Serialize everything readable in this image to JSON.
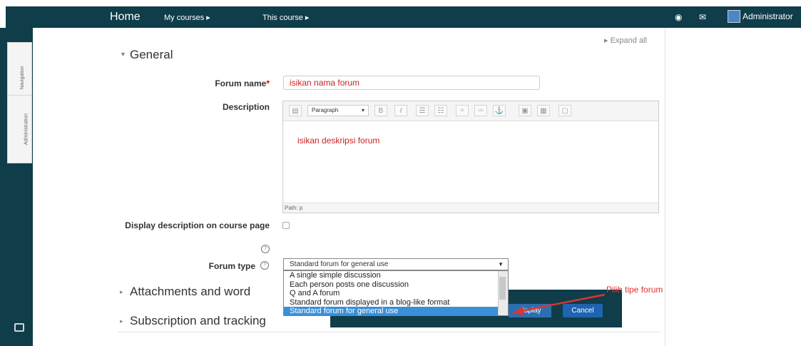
{
  "topbar": {
    "home": "Home",
    "my_courses": "My courses ▸",
    "this_course": "This course ▸",
    "user": "Administrator"
  },
  "left_dock": {
    "navigation": "Navigation",
    "administration": "Administration"
  },
  "form": {
    "expand_all": "Expand all",
    "general_title": "General",
    "forum_name_label": "Forum name",
    "forum_name_required": "*",
    "forum_name_value": "isikan nama forum",
    "description_label": "Description",
    "editor_format": "Paragraph",
    "description_value": "isikan deskripsi forum",
    "editor_path": "Path: p",
    "display_desc_label": "Display description on course page",
    "forum_type_label": "Forum type",
    "forum_type_selected": "Standard forum for general use",
    "forum_type_options": [
      "A single simple discussion",
      "Each person posts one discussion",
      "Q and A forum",
      "Standard forum displayed in a blog-like format",
      "Standard forum for general use"
    ],
    "attachments_title": "Attachments and word",
    "subscription_title": "Subscription and tracking"
  },
  "buttons": {
    "display": "display",
    "cancel": "Cancel"
  },
  "annotation": "Pilih tipe forum",
  "colors": {
    "dark_teal": "#0f3d4a",
    "accent_blue": "#3b8fd8",
    "annotation_red": "#d33"
  }
}
